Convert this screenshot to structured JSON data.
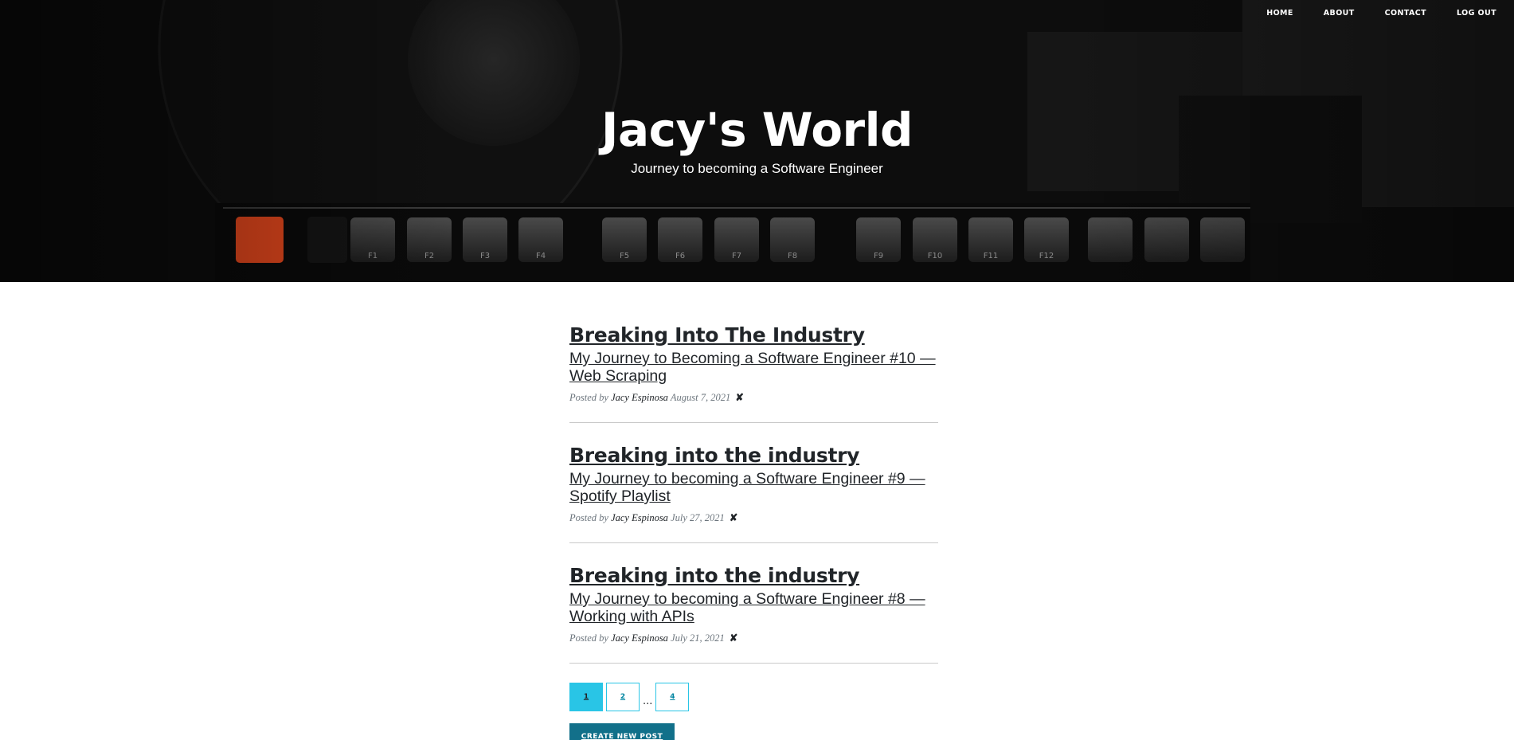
{
  "nav": {
    "items": [
      {
        "label": "HOME"
      },
      {
        "label": "ABOUT"
      },
      {
        "label": "CONTACT"
      },
      {
        "label": "LOG OUT"
      }
    ]
  },
  "hero": {
    "title": "Jacy's World",
    "subtitle": "Journey to becoming a Software Engineer",
    "function_keys": [
      "F1",
      "F2",
      "F3",
      "F4",
      "F5",
      "F6",
      "F7",
      "F8",
      "F9",
      "F10",
      "F11",
      "F12"
    ]
  },
  "posts": [
    {
      "title": "Breaking Into The Industry",
      "subtitle": "My Journey to Becoming a Software Engineer #10 — Web Scraping",
      "posted_by": "Posted by",
      "author": "Jacy Espinosa",
      "date": "August 7, 2021",
      "delete": "✘"
    },
    {
      "title": "Breaking into the industry",
      "subtitle": "My Journey to becoming a Software Engineer #9 — Spotify Playlist",
      "posted_by": "Posted by",
      "author": "Jacy Espinosa",
      "date": "July 27, 2021",
      "delete": "✘"
    },
    {
      "title": "Breaking into the industry",
      "subtitle": "My Journey to becoming a Software Engineer #8 — Working with APIs",
      "posted_by": "Posted by",
      "author": "Jacy Espinosa",
      "date": "July 21, 2021",
      "delete": "✘"
    }
  ],
  "pagination": {
    "pages": [
      "1",
      "2",
      "4"
    ],
    "ellipsis": "...",
    "active": "1"
  },
  "create_button": "CREATE NEW POST",
  "colors": {
    "accent": "#29c5e6",
    "button": "#12708a",
    "esc_key": "#e0461c"
  }
}
